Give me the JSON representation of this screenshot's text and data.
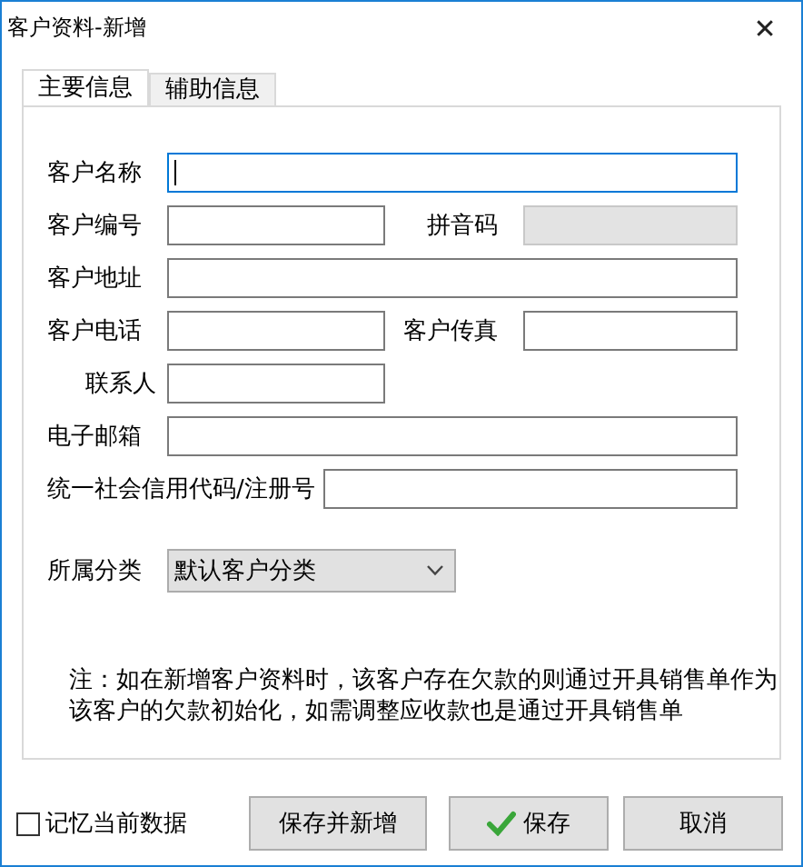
{
  "window": {
    "title": "客户资料-新增",
    "close": "✕"
  },
  "tabs": [
    {
      "label": "主要信息",
      "selected": true
    },
    {
      "label": "辅助信息",
      "selected": false
    }
  ],
  "form": {
    "rows": [
      {
        "items": [
          {
            "kind": "text",
            "label": "客户名称",
            "focused": true,
            "disabled": false
          }
        ]
      },
      {
        "items": [
          {
            "kind": "text",
            "label": "客户编号",
            "focused": false,
            "disabled": false
          },
          {
            "kind": "text",
            "label": "拼音码",
            "focused": false,
            "disabled": true
          }
        ]
      },
      {
        "items": [
          {
            "kind": "text",
            "label": "客户地址",
            "focused": false,
            "disabled": false
          }
        ]
      },
      {
        "items": [
          {
            "kind": "text",
            "label": "客户电话",
            "focused": false,
            "disabled": false
          },
          {
            "kind": "text",
            "label": "客户传真",
            "focused": false,
            "disabled": false
          }
        ]
      },
      {
        "items": [
          {
            "kind": "text",
            "label": "联系人",
            "focused": false,
            "disabled": false
          }
        ]
      },
      {
        "items": [
          {
            "kind": "text",
            "label": "电子邮箱",
            "focused": false,
            "disabled": false
          }
        ]
      },
      {
        "items": [
          {
            "kind": "text",
            "label": "统一社会信用代码/注册号",
            "focused": false,
            "disabled": false
          }
        ]
      },
      {
        "items": [
          {
            "kind": "select",
            "label": "所属分类",
            "value": "默认客户分类"
          }
        ]
      }
    ]
  },
  "note": "注：如在新增客户资料时，该客户存在欠款的则通过开具销售单作为该客户的欠款初始化，如需调整应收款也是通过开具销售单",
  "remember": {
    "label": "记忆当前数据",
    "checked": false
  },
  "buttons": [
    {
      "label": "保存并新增",
      "kind": "plain"
    },
    {
      "label": "保存",
      "kind": "confirm"
    },
    {
      "label": "取消",
      "kind": "plain"
    }
  ]
}
